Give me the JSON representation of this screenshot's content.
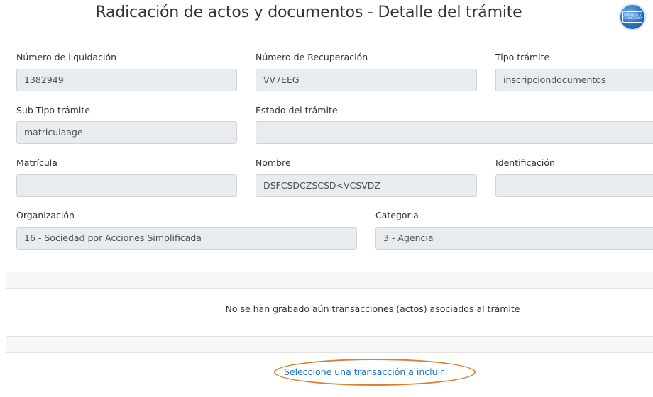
{
  "header": {
    "title": "Radicación de actos y documentos - Detalle del trámite",
    "badge_icon": "terms-conditions-icon",
    "badge_text": "TÉRMINOS Y CONDICIONES"
  },
  "fields": {
    "numero_liquidacion": {
      "label": "Número de liquidación",
      "value": "1382949"
    },
    "numero_recuperacion": {
      "label": "Número de Recuperación",
      "value": "VV7EEG"
    },
    "tipo_tramite": {
      "label": "Tipo trámite",
      "value": "inscripciondocumentos"
    },
    "sub_tipo_tramite": {
      "label": "Sub Tipo trámite",
      "value": "matriculaage"
    },
    "estado_tramite": {
      "label": "Estado del trámite",
      "value": "-"
    },
    "matricula": {
      "label": "Matrícula",
      "value": ""
    },
    "nombre": {
      "label": "Nombre",
      "value": "DSFCSDCZSCSD<VCSVDZ"
    },
    "identificacion": {
      "label": "Identificación",
      "value": ""
    },
    "organizacion": {
      "label": "Organización",
      "value": "16 - Sociedad por Acciones Simplificada"
    },
    "categoria": {
      "label": "Categoria",
      "value": "3 - Agencia"
    }
  },
  "transactions": {
    "empty_message": "No se han grabado aún transacciones (actos) asociados al trámite",
    "add_link": "Seleccione una transacción a incluir"
  },
  "colors": {
    "field_bg": "#e9ecef",
    "link": "#1a73c9",
    "highlight": "#e07b2c"
  }
}
